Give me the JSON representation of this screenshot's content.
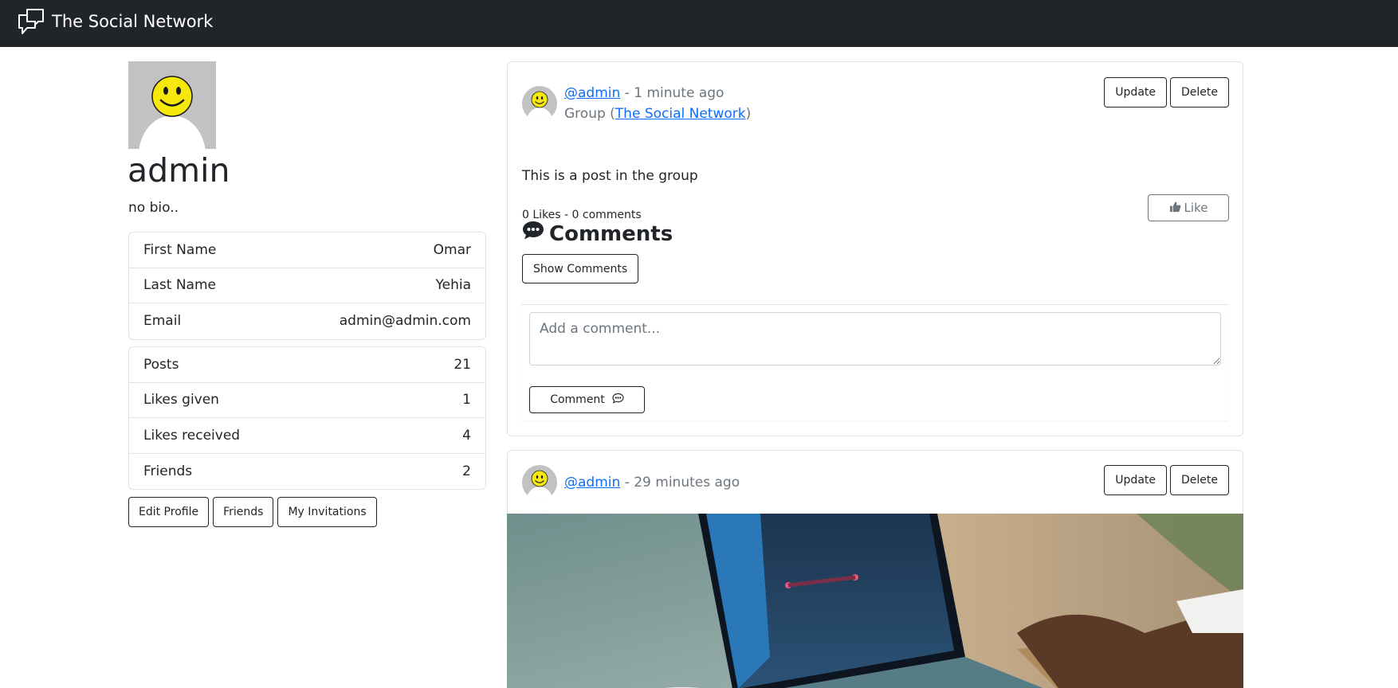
{
  "app": {
    "title": "The Social Network"
  },
  "profile": {
    "username": "admin",
    "bio": "no bio..",
    "info": [
      {
        "label": "First Name",
        "value": "Omar"
      },
      {
        "label": "Last Name",
        "value": "Yehia"
      },
      {
        "label": "Email",
        "value": "admin@admin.com"
      }
    ],
    "stats": [
      {
        "label": "Posts",
        "value": "21"
      },
      {
        "label": "Likes given",
        "value": "1"
      },
      {
        "label": "Likes received",
        "value": "4"
      },
      {
        "label": "Friends",
        "value": "2"
      }
    ],
    "buttons": {
      "edit": "Edit Profile",
      "friends": "Friends",
      "invitations": "My Invitations"
    }
  },
  "posts": [
    {
      "author": "@admin",
      "separator": " - ",
      "time": "1 minute ago",
      "group_prefix": "Group (",
      "group_name": "The Social Network",
      "group_suffix": ")",
      "text": "This is a post in the group",
      "stats": "0 Likes - 0 comments",
      "like_label": "Like",
      "comments_title": "Comments",
      "show_comments_label": "Show Comments",
      "comment_placeholder": "Add a comment...",
      "comment_button": "Comment",
      "update_label": "Update",
      "delete_label": "Delete"
    },
    {
      "author": "@admin",
      "separator": " - ",
      "time": "29 minutes ago",
      "update_label": "Update",
      "delete_label": "Delete"
    }
  ],
  "colors": {
    "navbar": "#212529",
    "link": "#0d6efd",
    "muted": "#6c757d",
    "smiley": "#f5e80a"
  },
  "icons": {
    "brand": "chat-bubbles-icon",
    "like": "thumbs-up-icon",
    "comments": "chat-dots-icon",
    "comment": "chat-bubble-icon"
  }
}
